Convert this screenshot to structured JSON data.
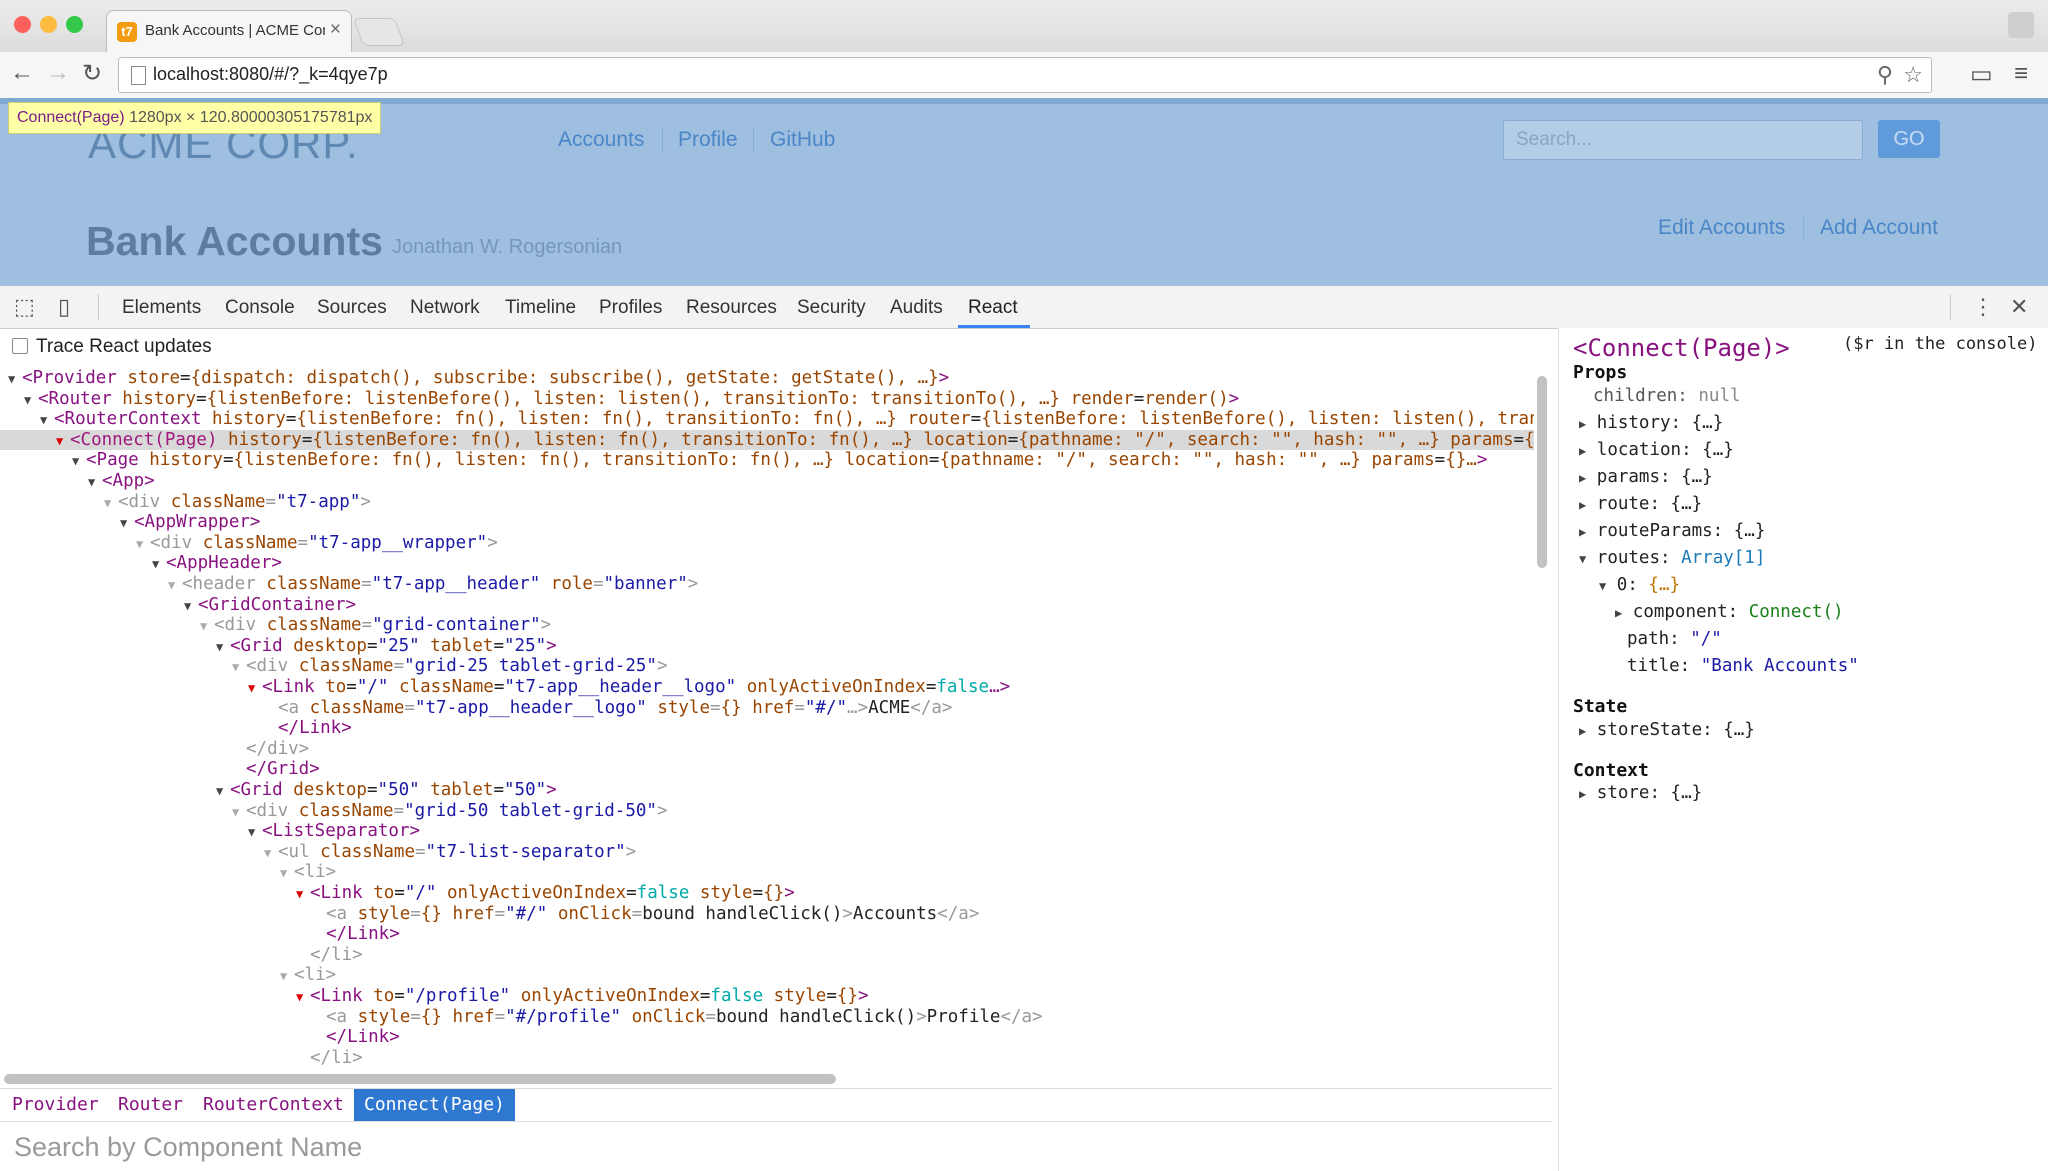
{
  "browser": {
    "tab_title": "Bank Accounts | ACME Cor",
    "tab_close": "×",
    "favicon": "t7",
    "url": "localhost:8080/#/?_k=4qye7p"
  },
  "app": {
    "logo": "ACME CORP.",
    "nav": [
      "Accounts",
      "Profile",
      "GitHub"
    ],
    "search_placeholder": "Search...",
    "go_label": "GO",
    "title": "Bank Accounts",
    "subtitle": "Jonathan W. Rogersonian",
    "actions": [
      "Edit Accounts",
      "Add Account"
    ]
  },
  "inspect_tooltip": {
    "name": "Connect(Page)",
    "dims": "1280px × 120.80000305175781px"
  },
  "devtools": {
    "tabs": [
      "Elements",
      "Console",
      "Sources",
      "Network",
      "Timeline",
      "Profiles",
      "Resources",
      "Security",
      "Audits",
      "React"
    ],
    "active_tab": "React",
    "trace_label": "Trace React updates",
    "breadcrumbs": [
      "Provider",
      "Router",
      "RouterContext",
      "Connect(Page)"
    ],
    "search_placeholder": "Search by Component Name",
    "side": {
      "title": "<Connect(Page)>",
      "console_hint": "($r in the console)",
      "props_label": "Props",
      "state_label": "State",
      "context_label": "Context",
      "children_key": "children:",
      "children_val": "null",
      "props": [
        {
          "key": "history:",
          "val": "{…}"
        },
        {
          "key": "location:",
          "val": "{…}"
        },
        {
          "key": "params:",
          "val": "{…}"
        },
        {
          "key": "route:",
          "val": "{…}"
        },
        {
          "key": "routeParams:",
          "val": "{…}"
        }
      ],
      "routes_key": "routes:",
      "routes_val": "Array[1]",
      "route0_key": "0:",
      "route0_val": "{…}",
      "component_key": "component:",
      "component_val": "Connect()",
      "path_key": "path:",
      "path_val": "\"/\"",
      "title_key": "title:",
      "title_val": "\"Bank Accounts\"",
      "state_key": "storeState:",
      "state_val": "{…}",
      "context_key": "store:",
      "context_val": "{…}"
    }
  },
  "tree": [
    {
      "indent": 0,
      "arrow": "▼",
      "parts": [
        [
          "tg",
          "<Provider "
        ],
        [
          "an",
          "store"
        ],
        [
          "tx",
          "="
        ],
        [
          "an",
          "{dispatch: dispatch(), subscribe: subscribe(), getState: getState(), …}"
        ],
        [
          "tg",
          ">"
        ]
      ]
    },
    {
      "indent": 1,
      "arrow": "▼",
      "parts": [
        [
          "tg",
          "<Router "
        ],
        [
          "an",
          "history"
        ],
        [
          "tx",
          "="
        ],
        [
          "an",
          "{listenBefore: listenBefore(), listen: listen(), transitionTo: transitionTo(), …}"
        ],
        [
          "tx",
          " "
        ],
        [
          "an",
          "render"
        ],
        [
          "tx",
          "="
        ],
        [
          "an",
          "render()"
        ],
        [
          "tg",
          ">"
        ]
      ]
    },
    {
      "indent": 2,
      "arrow": "▼",
      "parts": [
        [
          "tg",
          "<RouterContext "
        ],
        [
          "an",
          "history"
        ],
        [
          "tx",
          "="
        ],
        [
          "an",
          "{listenBefore: fn(), listen: fn(), transitionTo: fn(), …}"
        ],
        [
          "tx",
          " "
        ],
        [
          "an",
          "router"
        ],
        [
          "tx",
          "="
        ],
        [
          "an",
          "{listenBefore: listenBefore(), listen: listen(), tran"
        ]
      ]
    },
    {
      "indent": 3,
      "arrow": "▼",
      "sel": true,
      "parts": [
        [
          "tg",
          "<Connect(Page) "
        ],
        [
          "an",
          "history"
        ],
        [
          "tx",
          "="
        ],
        [
          "an",
          "{listenBefore: fn(), listen: fn(), transitionTo: fn(), …}"
        ],
        [
          "tx",
          " "
        ],
        [
          "an",
          "location"
        ],
        [
          "tx",
          "="
        ],
        [
          "an",
          "{pathname: \"/\", search: \"\", hash: \"\", …}"
        ],
        [
          "tx",
          " "
        ],
        [
          "an",
          "params"
        ],
        [
          "tx",
          "="
        ],
        [
          "an",
          "{"
        ]
      ]
    },
    {
      "indent": 4,
      "arrow": "▼",
      "parts": [
        [
          "tg",
          "<Page "
        ],
        [
          "an",
          "history"
        ],
        [
          "tx",
          "="
        ],
        [
          "an",
          "{listenBefore: fn(), listen: fn(), transitionTo: fn(), …}"
        ],
        [
          "tx",
          " "
        ],
        [
          "an",
          "location"
        ],
        [
          "tx",
          "="
        ],
        [
          "an",
          "{pathname: \"/\", search: \"\", hash: \"\", …}"
        ],
        [
          "tx",
          " "
        ],
        [
          "an",
          "params"
        ],
        [
          "tx",
          "="
        ],
        [
          "an",
          "{}…"
        ],
        [
          "tg",
          ">"
        ]
      ]
    },
    {
      "indent": 5,
      "arrow": "▼",
      "parts": [
        [
          "tg",
          "<App>"
        ]
      ]
    },
    {
      "indent": 6,
      "arrow": "▼",
      "gray": true,
      "parts": [
        [
          "tgg",
          "<div "
        ],
        [
          "an",
          "className"
        ],
        [
          "tgg",
          "="
        ],
        [
          "av",
          "\"t7-app\""
        ],
        [
          "tgg",
          ">"
        ]
      ]
    },
    {
      "indent": 7,
      "arrow": "▼",
      "parts": [
        [
          "tg",
          "<AppWrapper>"
        ]
      ]
    },
    {
      "indent": 8,
      "arrow": "▼",
      "gray": true,
      "parts": [
        [
          "tgg",
          "<div "
        ],
        [
          "an",
          "className"
        ],
        [
          "tgg",
          "="
        ],
        [
          "av",
          "\"t7-app__wrapper\""
        ],
        [
          "tgg",
          ">"
        ]
      ]
    },
    {
      "indent": 9,
      "arrow": "▼",
      "parts": [
        [
          "tg",
          "<AppHeader>"
        ]
      ]
    },
    {
      "indent": 10,
      "arrow": "▼",
      "gray": true,
      "parts": [
        [
          "tgg",
          "<header "
        ],
        [
          "an",
          "className"
        ],
        [
          "tgg",
          "="
        ],
        [
          "av",
          "\"t7-app__header\""
        ],
        [
          "tx",
          " "
        ],
        [
          "an",
          "role"
        ],
        [
          "tgg",
          "="
        ],
        [
          "av",
          "\"banner\""
        ],
        [
          "tgg",
          ">"
        ]
      ]
    },
    {
      "indent": 11,
      "arrow": "▼",
      "parts": [
        [
          "tg",
          "<GridContainer>"
        ]
      ]
    },
    {
      "indent": 12,
      "arrow": "▼",
      "gray": true,
      "parts": [
        [
          "tgg",
          "<div "
        ],
        [
          "an",
          "className"
        ],
        [
          "tgg",
          "="
        ],
        [
          "av",
          "\"grid-container\""
        ],
        [
          "tgg",
          ">"
        ]
      ]
    },
    {
      "indent": 13,
      "arrow": "▼",
      "parts": [
        [
          "tg",
          "<Grid "
        ],
        [
          "an",
          "desktop"
        ],
        [
          "tx",
          "="
        ],
        [
          "av",
          "\"25\""
        ],
        [
          "tx",
          " "
        ],
        [
          "an",
          "tablet"
        ],
        [
          "tx",
          "="
        ],
        [
          "av",
          "\"25\""
        ],
        [
          "tg",
          ">"
        ]
      ]
    },
    {
      "indent": 14,
      "arrow": "▼",
      "gray": true,
      "parts": [
        [
          "tgg",
          "<div "
        ],
        [
          "an",
          "className"
        ],
        [
          "tgg",
          "="
        ],
        [
          "av",
          "\"grid-25 tablet-grid-25\""
        ],
        [
          "tgg",
          ">"
        ]
      ]
    },
    {
      "indent": 15,
      "arrow": "▼",
      "red": true,
      "parts": [
        [
          "tg",
          "<Link "
        ],
        [
          "an",
          "to"
        ],
        [
          "tx",
          "="
        ],
        [
          "av",
          "\"/\""
        ],
        [
          "tx",
          " "
        ],
        [
          "an",
          "className"
        ],
        [
          "tx",
          "="
        ],
        [
          "av",
          "\"t7-app__header__logo\""
        ],
        [
          "tx",
          " "
        ],
        [
          "an",
          "onlyActiveOnIndex"
        ],
        [
          "tx",
          "="
        ],
        [
          "ab",
          "false"
        ],
        [
          "tg",
          "…>"
        ]
      ]
    },
    {
      "indent": 16,
      "arrow": "",
      "parts": [
        [
          "tgg",
          "<a "
        ],
        [
          "an",
          "className"
        ],
        [
          "tgg",
          "="
        ],
        [
          "av",
          "\"t7-app__header__logo\""
        ],
        [
          "tx",
          " "
        ],
        [
          "an",
          "style"
        ],
        [
          "tgg",
          "="
        ],
        [
          "an",
          "{}"
        ],
        [
          "tx",
          " "
        ],
        [
          "an",
          "href"
        ],
        [
          "tgg",
          "="
        ],
        [
          "av",
          "\"#/\""
        ],
        [
          "tgg",
          "…>"
        ],
        [
          "tx",
          "ACME"
        ],
        [
          "tgg",
          "</a>"
        ]
      ]
    },
    {
      "indent": 16,
      "arrow": "",
      "parts": [
        [
          "tg",
          "</Link>"
        ]
      ]
    },
    {
      "indent": 14,
      "arrow": "",
      "parts": [
        [
          "tgg",
          "</div>"
        ]
      ]
    },
    {
      "indent": 14,
      "arrow": "",
      "parts": [
        [
          "tg",
          "</Grid>"
        ]
      ]
    },
    {
      "indent": 13,
      "arrow": "▼",
      "parts": [
        [
          "tg",
          "<Grid "
        ],
        [
          "an",
          "desktop"
        ],
        [
          "tx",
          "="
        ],
        [
          "av",
          "\"50\""
        ],
        [
          "tx",
          " "
        ],
        [
          "an",
          "tablet"
        ],
        [
          "tx",
          "="
        ],
        [
          "av",
          "\"50\""
        ],
        [
          "tg",
          ">"
        ]
      ]
    },
    {
      "indent": 14,
      "arrow": "▼",
      "gray": true,
      "parts": [
        [
          "tgg",
          "<div "
        ],
        [
          "an",
          "className"
        ],
        [
          "tgg",
          "="
        ],
        [
          "av",
          "\"grid-50 tablet-grid-50\""
        ],
        [
          "tgg",
          ">"
        ]
      ]
    },
    {
      "indent": 15,
      "arrow": "▼",
      "parts": [
        [
          "tg",
          "<ListSeparator>"
        ]
      ]
    },
    {
      "indent": 16,
      "arrow": "▼",
      "gray": true,
      "parts": [
        [
          "tgg",
          "<ul "
        ],
        [
          "an",
          "className"
        ],
        [
          "tgg",
          "="
        ],
        [
          "av",
          "\"t7-list-separator\""
        ],
        [
          "tgg",
          ">"
        ]
      ]
    },
    {
      "indent": 17,
      "arrow": "▼",
      "gray": true,
      "parts": [
        [
          "tgg",
          "<li>"
        ]
      ]
    },
    {
      "indent": 18,
      "arrow": "▼",
      "red": true,
      "parts": [
        [
          "tg",
          "<Link "
        ],
        [
          "an",
          "to"
        ],
        [
          "tx",
          "="
        ],
        [
          "av",
          "\"/\""
        ],
        [
          "tx",
          " "
        ],
        [
          "an",
          "onlyActiveOnIndex"
        ],
        [
          "tx",
          "="
        ],
        [
          "ab",
          "false"
        ],
        [
          "tx",
          " "
        ],
        [
          "an",
          "style"
        ],
        [
          "tx",
          "="
        ],
        [
          "an",
          "{}"
        ],
        [
          "tg",
          ">"
        ]
      ]
    },
    {
      "indent": 19,
      "arrow": "",
      "parts": [
        [
          "tgg",
          "<a "
        ],
        [
          "an",
          "style"
        ],
        [
          "tgg",
          "="
        ],
        [
          "an",
          "{}"
        ],
        [
          "tx",
          " "
        ],
        [
          "an",
          "href"
        ],
        [
          "tgg",
          "="
        ],
        [
          "av",
          "\"#/\""
        ],
        [
          "tx",
          " "
        ],
        [
          "an",
          "onClick"
        ],
        [
          "tgg",
          "="
        ],
        [
          "tx",
          "bound handleClick()"
        ],
        [
          "tgg",
          ">"
        ],
        [
          "tx",
          "Accounts"
        ],
        [
          "tgg",
          "</a>"
        ]
      ]
    },
    {
      "indent": 19,
      "arrow": "",
      "parts": [
        [
          "tg",
          "</Link>"
        ]
      ]
    },
    {
      "indent": 18,
      "arrow": "",
      "parts": [
        [
          "tgg",
          "</li>"
        ]
      ]
    },
    {
      "indent": 17,
      "arrow": "▼",
      "gray": true,
      "parts": [
        [
          "tgg",
          "<li>"
        ]
      ]
    },
    {
      "indent": 18,
      "arrow": "▼",
      "red": true,
      "parts": [
        [
          "tg",
          "<Link "
        ],
        [
          "an",
          "to"
        ],
        [
          "tx",
          "="
        ],
        [
          "av",
          "\"/profile\""
        ],
        [
          "tx",
          " "
        ],
        [
          "an",
          "onlyActiveOnIndex"
        ],
        [
          "tx",
          "="
        ],
        [
          "ab",
          "false"
        ],
        [
          "tx",
          " "
        ],
        [
          "an",
          "style"
        ],
        [
          "tx",
          "="
        ],
        [
          "an",
          "{}"
        ],
        [
          "tg",
          ">"
        ]
      ]
    },
    {
      "indent": 19,
      "arrow": "",
      "parts": [
        [
          "tgg",
          "<a "
        ],
        [
          "an",
          "style"
        ],
        [
          "tgg",
          "="
        ],
        [
          "an",
          "{}"
        ],
        [
          "tx",
          " "
        ],
        [
          "an",
          "href"
        ],
        [
          "tgg",
          "="
        ],
        [
          "av",
          "\"#/profile\""
        ],
        [
          "tx",
          " "
        ],
        [
          "an",
          "onClick"
        ],
        [
          "tgg",
          "="
        ],
        [
          "tx",
          "bound handleClick()"
        ],
        [
          "tgg",
          ">"
        ],
        [
          "tx",
          "Profile"
        ],
        [
          "tgg",
          "</a>"
        ]
      ]
    },
    {
      "indent": 19,
      "arrow": "",
      "parts": [
        [
          "tg",
          "</Link>"
        ]
      ]
    },
    {
      "indent": 18,
      "arrow": "",
      "parts": [
        [
          "tgg",
          "</li>"
        ]
      ]
    }
  ]
}
